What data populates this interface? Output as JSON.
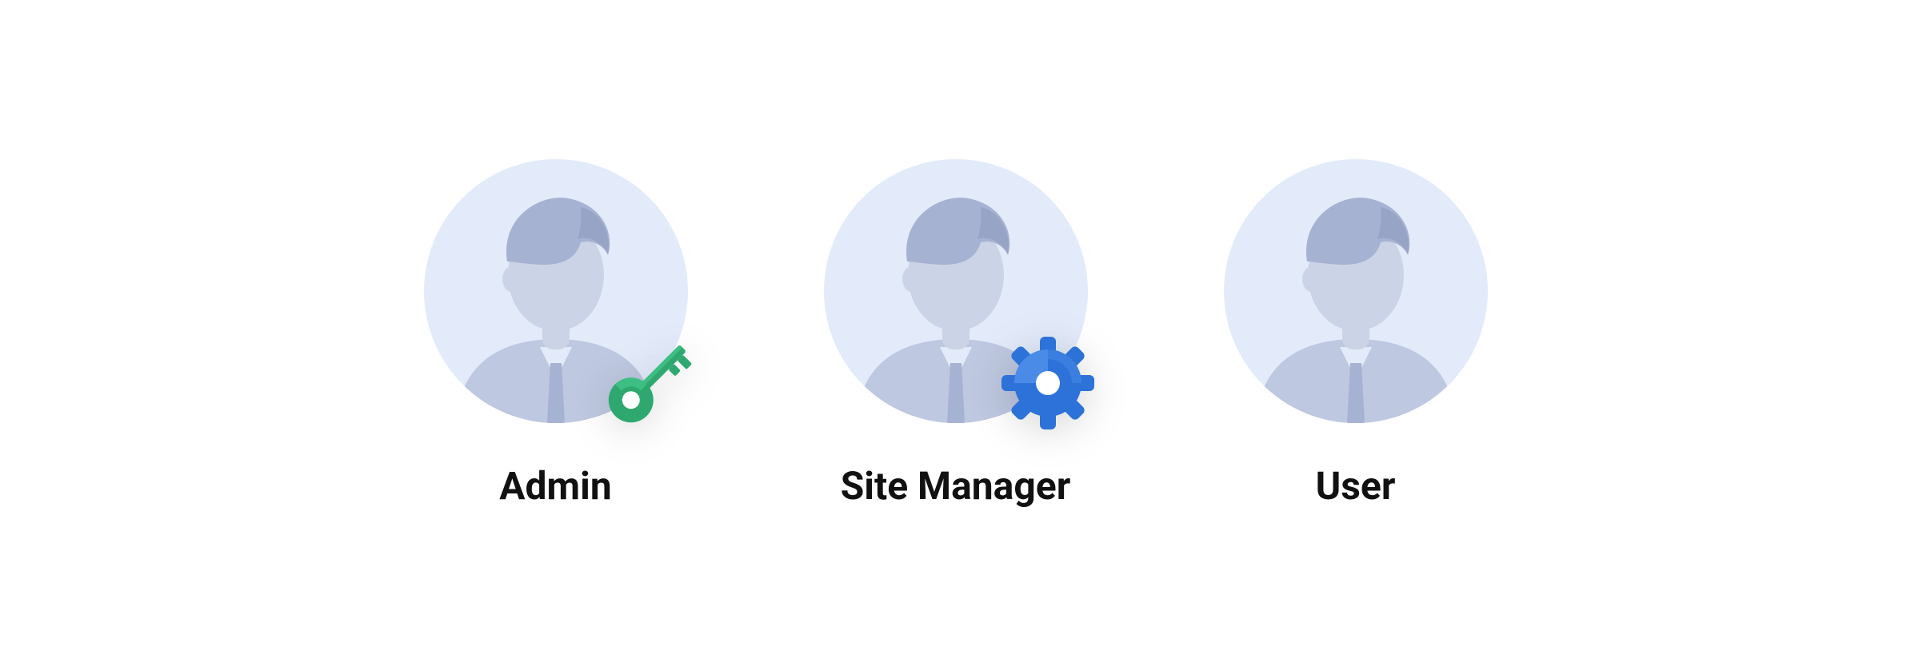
{
  "roles": [
    {
      "label": "Admin",
      "badge": "key"
    },
    {
      "label": "Site Manager",
      "badge": "gear"
    },
    {
      "label": "User",
      "badge": null
    }
  ],
  "colors": {
    "avatar_bg": "#E3EBFA",
    "avatar_hair": "#A6B2D1",
    "avatar_body": "#BEC8E0",
    "avatar_skin": "#CBD3E6",
    "key": "#2EA86F",
    "key_light": "#3DBE82",
    "gear": "#2D72D9",
    "gear_light": "#4A8BE8"
  }
}
